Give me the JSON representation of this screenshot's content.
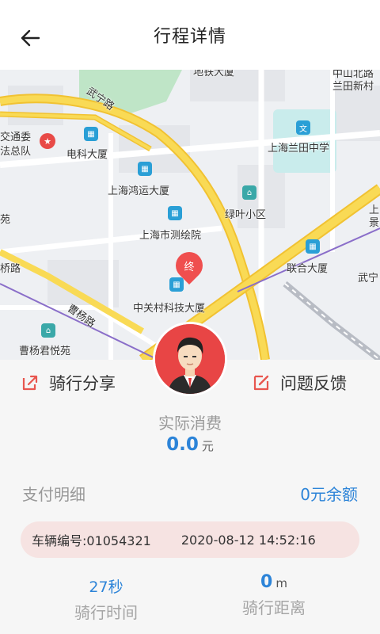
{
  "header": {
    "title": "行程详情",
    "back_icon": "arrow-left-icon"
  },
  "map": {
    "labels": {
      "wuning_road": "武宁路",
      "traffic_committee": "交通委",
      "law_team": "法总队",
      "dianke_building": "电科大厦",
      "hongyun_building": "上海鸿运大厦",
      "survey_institute": "上海市测绘院",
      "lvye_community": "绿叶小区",
      "lantian_school": "上海兰田中学",
      "lianhe_building": "联合大厦",
      "zhongguancun_building": "中关村科技大厦",
      "caoyang_road": "曹杨路",
      "caoyang_junyue": "曹杨君悦苑",
      "zhongshan_north": "中山北路",
      "lantian_village": "兰田新村",
      "qiao_road": "桥路",
      "wuning_short": "武宁",
      "yuan": "苑",
      "shang": "上",
      "jing": "景",
      "top_cut": "地铁大厦",
      "end_marker": "终"
    }
  },
  "actions": {
    "share_label": "骑行分享",
    "feedback_label": "问题反馈"
  },
  "consumption": {
    "label": "实际消费",
    "value": "0.0",
    "unit": "元"
  },
  "payment": {
    "detail_label": "支付明细",
    "balance_label": "0元余额"
  },
  "trip_info": {
    "vehicle": "车辆编号:01054321",
    "time": "2020-08-12 14:52:16"
  },
  "stats": {
    "duration_value": "27秒",
    "duration_label": "骑行时间",
    "distance_value": "0",
    "distance_unit": "m",
    "distance_label": "骑行距离"
  },
  "colors": {
    "accent_blue": "#2d84d8",
    "pill_bg": "#f6e3e2",
    "avatar_red": "#e84545",
    "road_yellow": "#f7d23a"
  }
}
